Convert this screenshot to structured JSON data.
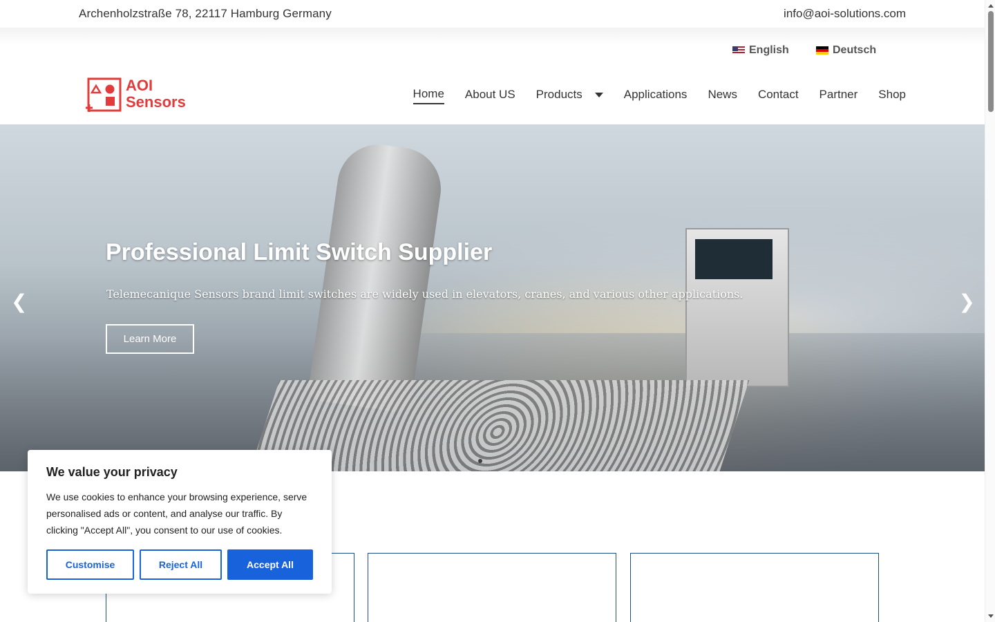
{
  "topbar": {
    "address": "Archenholzstraße 78, 22117 Hamburg Germany",
    "email": "info@aoi-solutions.com"
  },
  "languages": [
    {
      "label": "English",
      "flag": "us-flag-icon"
    },
    {
      "label": "Deutsch",
      "flag": "de-flag-icon"
    }
  ],
  "logo": {
    "line1": "AOI",
    "line2": "Sensors",
    "color": "#e23b3b"
  },
  "nav": {
    "items": [
      {
        "label": "Home",
        "active": true
      },
      {
        "label": "About US"
      },
      {
        "label": "Products",
        "dropdown": true
      },
      {
        "label": "Applications"
      },
      {
        "label": "News"
      },
      {
        "label": "Contact"
      },
      {
        "label": "Partner"
      },
      {
        "label": "Shop"
      }
    ]
  },
  "hero": {
    "title": "Professional Limit Switch Supplier",
    "subtitle": "Telemecanique Sensors brand limit switches are widely used in elevators, cranes, and various other applications.",
    "cta": "Learn More",
    "prev_icon": "chevron-left-icon",
    "next_icon": "chevron-right-icon"
  },
  "cookie": {
    "title": "We value your privacy",
    "body": "We use cookies to enhance your browsing experience, serve personalised ads or content, and analyse our traffic. By clicking \"Accept All\", you consent to our use of cookies.",
    "customise": "Customise",
    "reject": "Reject All",
    "accept": "Accept All",
    "accent": "#1863dc"
  },
  "colors": {
    "card_border": "#1b4e86"
  }
}
